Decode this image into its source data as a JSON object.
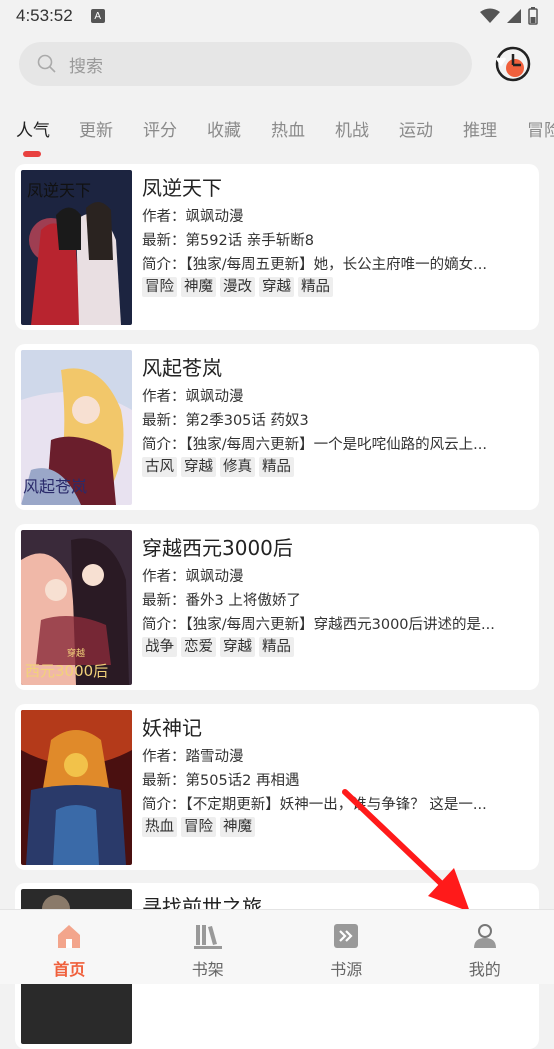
{
  "status_bar": {
    "time": "4:53:52",
    "badge": "A"
  },
  "search": {
    "placeholder": "搜索"
  },
  "tabs": [
    "人气",
    "更新",
    "评分",
    "收藏",
    "热血",
    "机战",
    "运动",
    "推理",
    "冒险"
  ],
  "active_tab": "人气",
  "comics": [
    {
      "title": "凤逆天下",
      "author": "作者：飒飒动漫",
      "latest": "最新：第592话 亲手斩断8",
      "intro": "简介：【独家/每周五更新】她，长公主府唯一的嫡女...",
      "tags": [
        "冒险",
        "神魔",
        "漫改",
        "穿越",
        "精品"
      ]
    },
    {
      "title": "风起苍岚",
      "author": "作者：飒飒动漫",
      "latest": "最新：第2季305话 药奴3",
      "intro": "简介：【独家/每周六更新】一个是叱咤仙路的风云上...",
      "tags": [
        "古风",
        "穿越",
        "修真",
        "精品"
      ]
    },
    {
      "title": "穿越西元3000后",
      "author": "作者：飒飒动漫",
      "latest": "最新：番外3 上将傲娇了",
      "intro": "简介：【独家/每周六更新】穿越西元3000后讲述的是...",
      "tags": [
        "战争",
        "恋爱",
        "穿越",
        "精品"
      ]
    },
    {
      "title": "妖神记",
      "author": "作者：踏雪动漫",
      "latest": "最新：第505话2 再相遇",
      "intro": "简介：【不定期更新】妖神一出，谁与争锋？ 这是一...",
      "tags": [
        "热血",
        "冒险",
        "神魔"
      ]
    },
    {
      "title": "寻找前世之旅",
      "author": "",
      "latest": "",
      "intro": "",
      "tags": []
    }
  ],
  "cover_texts": [
    "凤逆天下",
    "风起苍岚",
    "穿越",
    "西元3000后"
  ],
  "bottom_nav": [
    {
      "label": "首页",
      "icon": "home-icon",
      "active": true
    },
    {
      "label": "书架",
      "icon": "bookshelf-icon",
      "active": false
    },
    {
      "label": "书源",
      "icon": "source-icon",
      "active": false
    },
    {
      "label": "我的",
      "icon": "profile-icon",
      "active": false
    }
  ],
  "colors": {
    "accent": "#e8413f",
    "nav_active": "#f0603c",
    "background": "#f2f2f2"
  }
}
